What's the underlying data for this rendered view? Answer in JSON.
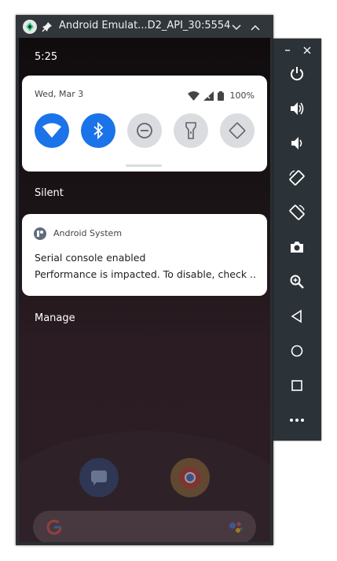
{
  "window": {
    "title": "Android Emulat...D2_API_30:5554"
  },
  "status_bar": {
    "time": "5:25"
  },
  "quick_settings": {
    "date": "Wed, Mar 3",
    "battery": "100%",
    "tiles": [
      {
        "name": "wifi",
        "state": "on"
      },
      {
        "name": "bluetooth",
        "state": "on"
      },
      {
        "name": "do-not-disturb",
        "state": "off"
      },
      {
        "name": "flashlight",
        "state": "off"
      },
      {
        "name": "auto-rotate",
        "state": "off"
      }
    ]
  },
  "sections": {
    "silent": "Silent",
    "manage": "Manage"
  },
  "notification": {
    "app": "Android System",
    "title": "Serial console enabled",
    "text": "Performance is impacted. To disable, check .."
  },
  "toolbar": {
    "buttons": [
      "power",
      "volume-up",
      "volume-down",
      "rotate-left",
      "rotate-right",
      "screenshot",
      "zoom",
      "back",
      "home",
      "overview",
      "more"
    ]
  },
  "colors": {
    "accent": "#1a73e8",
    "titlebar": "#31363b",
    "toolbar": "#2b3238"
  }
}
